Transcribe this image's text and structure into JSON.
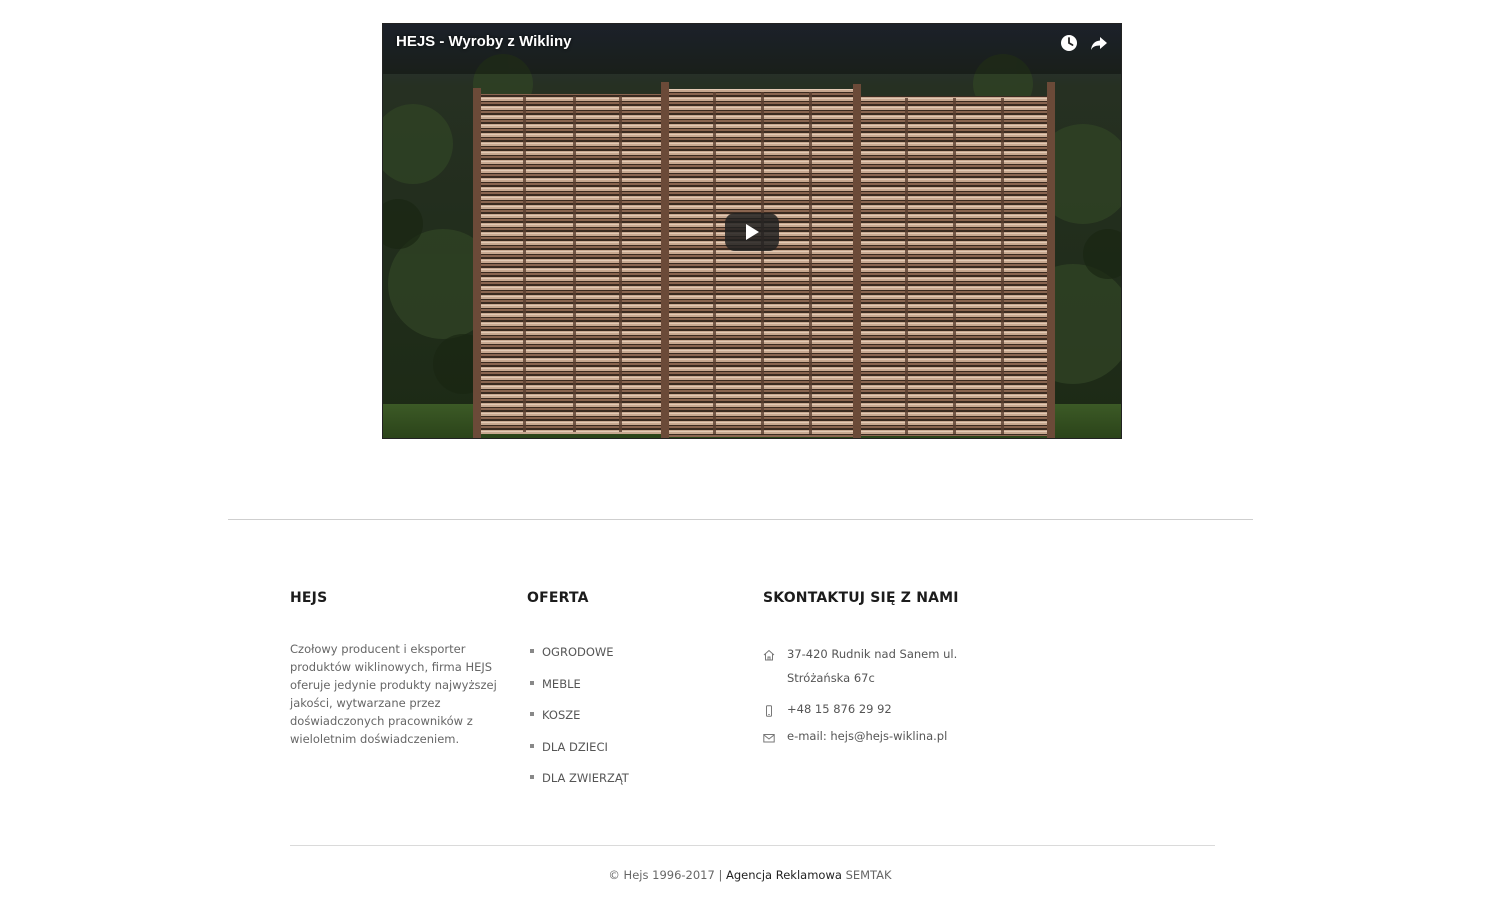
{
  "video": {
    "title": "HEJS - Wyroby z Wikliny",
    "icons": [
      "watch-later-icon",
      "share-icon",
      "play-icon"
    ]
  },
  "footer": {
    "about": {
      "title": "HEJS",
      "text": "Czołowy producent i eksporter produktów wiklinowych, firma HEJS oferuje jedynie produkty najwyższej jakości, wytwarzane przez doświadczonych pracowników z wieloletnim doświadczeniem."
    },
    "offer": {
      "title": "OFERTA",
      "items": [
        {
          "label": "OGRODOWE"
        },
        {
          "label": "MEBLE"
        },
        {
          "label": "KOSZE"
        },
        {
          "label": "DLA DZIECI"
        },
        {
          "label": "DLA ZWIERZĄT"
        }
      ]
    },
    "contact": {
      "title": "SKONTAKTUJ SIĘ Z NAMI",
      "address_line1": "37-420 Rudnik nad Sanem ul.",
      "address_line2": "Stróżańska 67c",
      "phone": "+48 15 876 29 92",
      "email": "e-mail: hejs@hejs-wiklina.pl",
      "icons": [
        "home-icon",
        "phone-icon",
        "envelope-icon"
      ]
    },
    "copyright": {
      "text": "© Hejs 1996-2017 |",
      "agency": "Agencja Reklamowa",
      "agency_link": "SEMTAK"
    }
  },
  "colors": {
    "text": "#555555",
    "heading": "#1c1c1c",
    "divider": "#cfcfcf"
  }
}
